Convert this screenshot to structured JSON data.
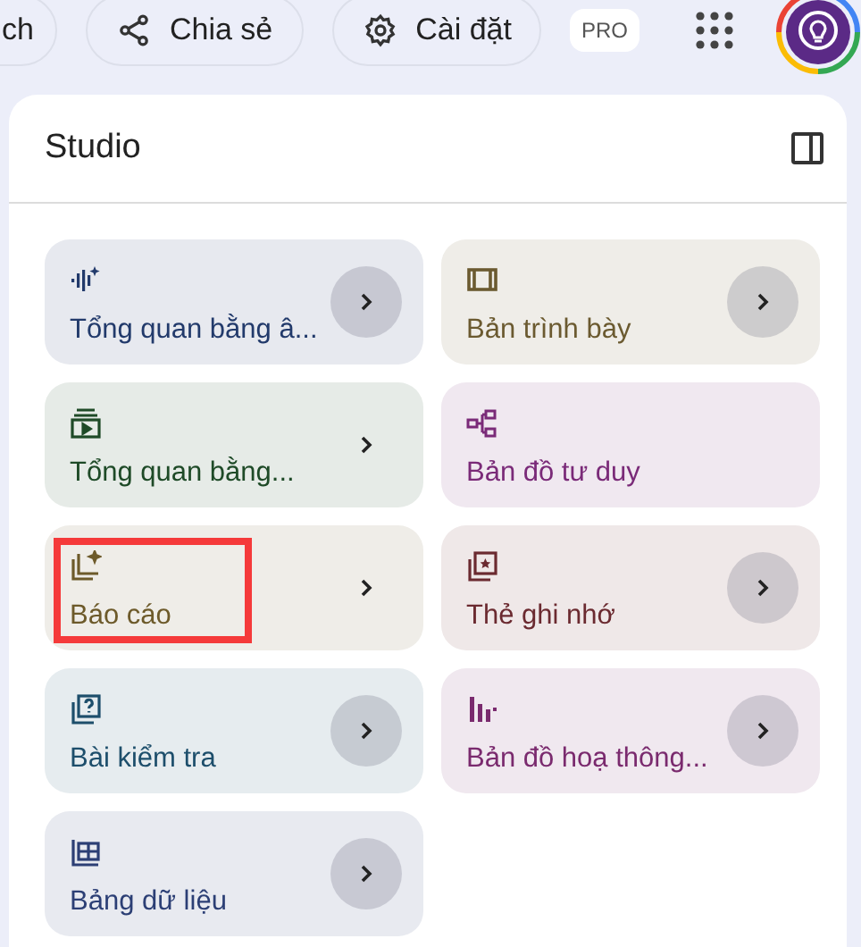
{
  "top_bar": {
    "partial_button": "ch",
    "share_button": "Chia sẻ",
    "settings_button": "Cài đặt",
    "badge": "PRO"
  },
  "studio": {
    "title": "Studio",
    "items": [
      {
        "label": "Tổng quan bằng â...",
        "color": "#223a6b",
        "chevron": true,
        "chevron_circle": true,
        "highlighted": false
      },
      {
        "label": "Bản trình bày",
        "color": "#6b5a30",
        "chevron": true,
        "chevron_circle": true,
        "highlighted": false
      },
      {
        "label": "Tổng quan bằng...",
        "color": "#1e4a27",
        "chevron": true,
        "chevron_circle": false,
        "highlighted": false
      },
      {
        "label": "Bản đồ tư duy",
        "color": "#7a2a78",
        "chevron": false,
        "highlighted": false
      },
      {
        "label": "Báo cáo",
        "color": "#6d5a2a",
        "chevron": true,
        "chevron_circle": false,
        "highlighted": true
      },
      {
        "label": "Thẻ ghi nhớ",
        "color": "#6b2a30",
        "chevron": true,
        "chevron_circle": true,
        "highlighted": false
      },
      {
        "label": "Bài kiểm tra",
        "color": "#1d4e6b",
        "chevron": true,
        "chevron_circle": true,
        "highlighted": false
      },
      {
        "label": "Bản đồ hoạ thông...",
        "color": "#7a2a6e",
        "chevron": true,
        "chevron_circle": true,
        "highlighted": false
      },
      {
        "label": "Bảng dữ liệu",
        "color": "#2c3f75",
        "chevron": true,
        "chevron_circle": true,
        "highlighted": false
      }
    ]
  }
}
